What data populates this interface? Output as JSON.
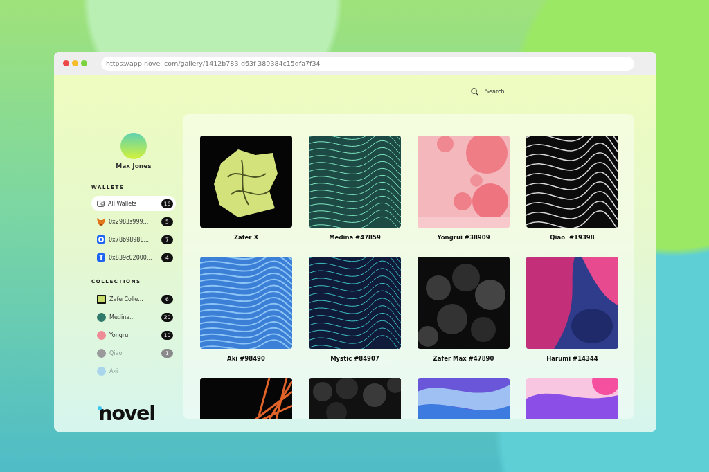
{
  "window": {
    "url": "https://app.novel.com/gallery/1412b783-d63f-389384c15dfa7f34"
  },
  "search": {
    "placeholder": "Search"
  },
  "profile": {
    "name": "Max Jones"
  },
  "wallets": {
    "heading": "WALLETS",
    "items": [
      {
        "kind": "wallet",
        "label": "All Wallets",
        "count": "16",
        "selected": true
      },
      {
        "kind": "fox",
        "label": "0x2983s999...",
        "count": "5",
        "selected": false
      },
      {
        "kind": "ring",
        "label": "0x78b9898E...",
        "count": "7",
        "selected": false
      },
      {
        "kind": "letter",
        "glyph": "T",
        "label": "0x839c02000...",
        "count": "4",
        "selected": false
      }
    ]
  },
  "collections": {
    "heading": "COLLECTIONS",
    "items": [
      {
        "label": "ZaferColle...",
        "count": "6",
        "color": "#c9dd6a",
        "faded": false
      },
      {
        "label": "Medina...",
        "count": "20",
        "color": "#2f7a6a",
        "faded": false
      },
      {
        "label": "Yongrui",
        "count": "10",
        "color": "#f08a94",
        "faded": false
      },
      {
        "label": "Qiao",
        "count": "1",
        "color": "#9a9a9a",
        "faded": true
      },
      {
        "label": "Aki",
        "color": "#a9d6ec",
        "faded": true
      }
    ]
  },
  "logo": {
    "text": "novel"
  },
  "gallery": [
    {
      "kind": "picture",
      "title": "Zafer X"
    },
    {
      "kind": "picture",
      "title": "Medina #47859"
    },
    {
      "kind": "picture",
      "title": "Yongrui #38909"
    },
    {
      "kind": "picture",
      "title": "Qiao  #19398"
    },
    {
      "kind": "picture",
      "title": "Aki #98490"
    },
    {
      "kind": "picture",
      "title": "Mystic #84907"
    },
    {
      "kind": "picture",
      "title": "Zafer Max #47890"
    },
    {
      "kind": "picture",
      "title": "Harumi #14344"
    },
    {
      "kind": "picture"
    },
    {
      "kind": "picture"
    },
    {
      "kind": "picture"
    },
    {
      "kind": "picture"
    }
  ]
}
